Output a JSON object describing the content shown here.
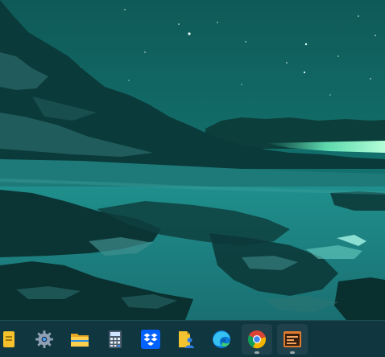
{
  "desktop": {
    "wallpaper": "night-mountain-lake"
  },
  "taskbar": {
    "background": "#103640",
    "apps": [
      {
        "name": "sticky-notes",
        "icon": "note-icon",
        "running": false
      },
      {
        "name": "settings",
        "icon": "gear-icon",
        "running": false
      },
      {
        "name": "file-explorer",
        "icon": "folder-icon",
        "running": false
      },
      {
        "name": "calculator",
        "icon": "calculator-icon",
        "running": false
      },
      {
        "name": "dropbox",
        "icon": "dropbox-icon",
        "running": false
      },
      {
        "name": "documents-user",
        "icon": "user-documents-icon",
        "running": false
      },
      {
        "name": "microsoft-edge",
        "icon": "edge-icon",
        "running": false
      },
      {
        "name": "google-chrome",
        "icon": "chrome-icon",
        "running": true
      },
      {
        "name": "media-app",
        "icon": "media-window-icon",
        "running": true
      }
    ]
  }
}
